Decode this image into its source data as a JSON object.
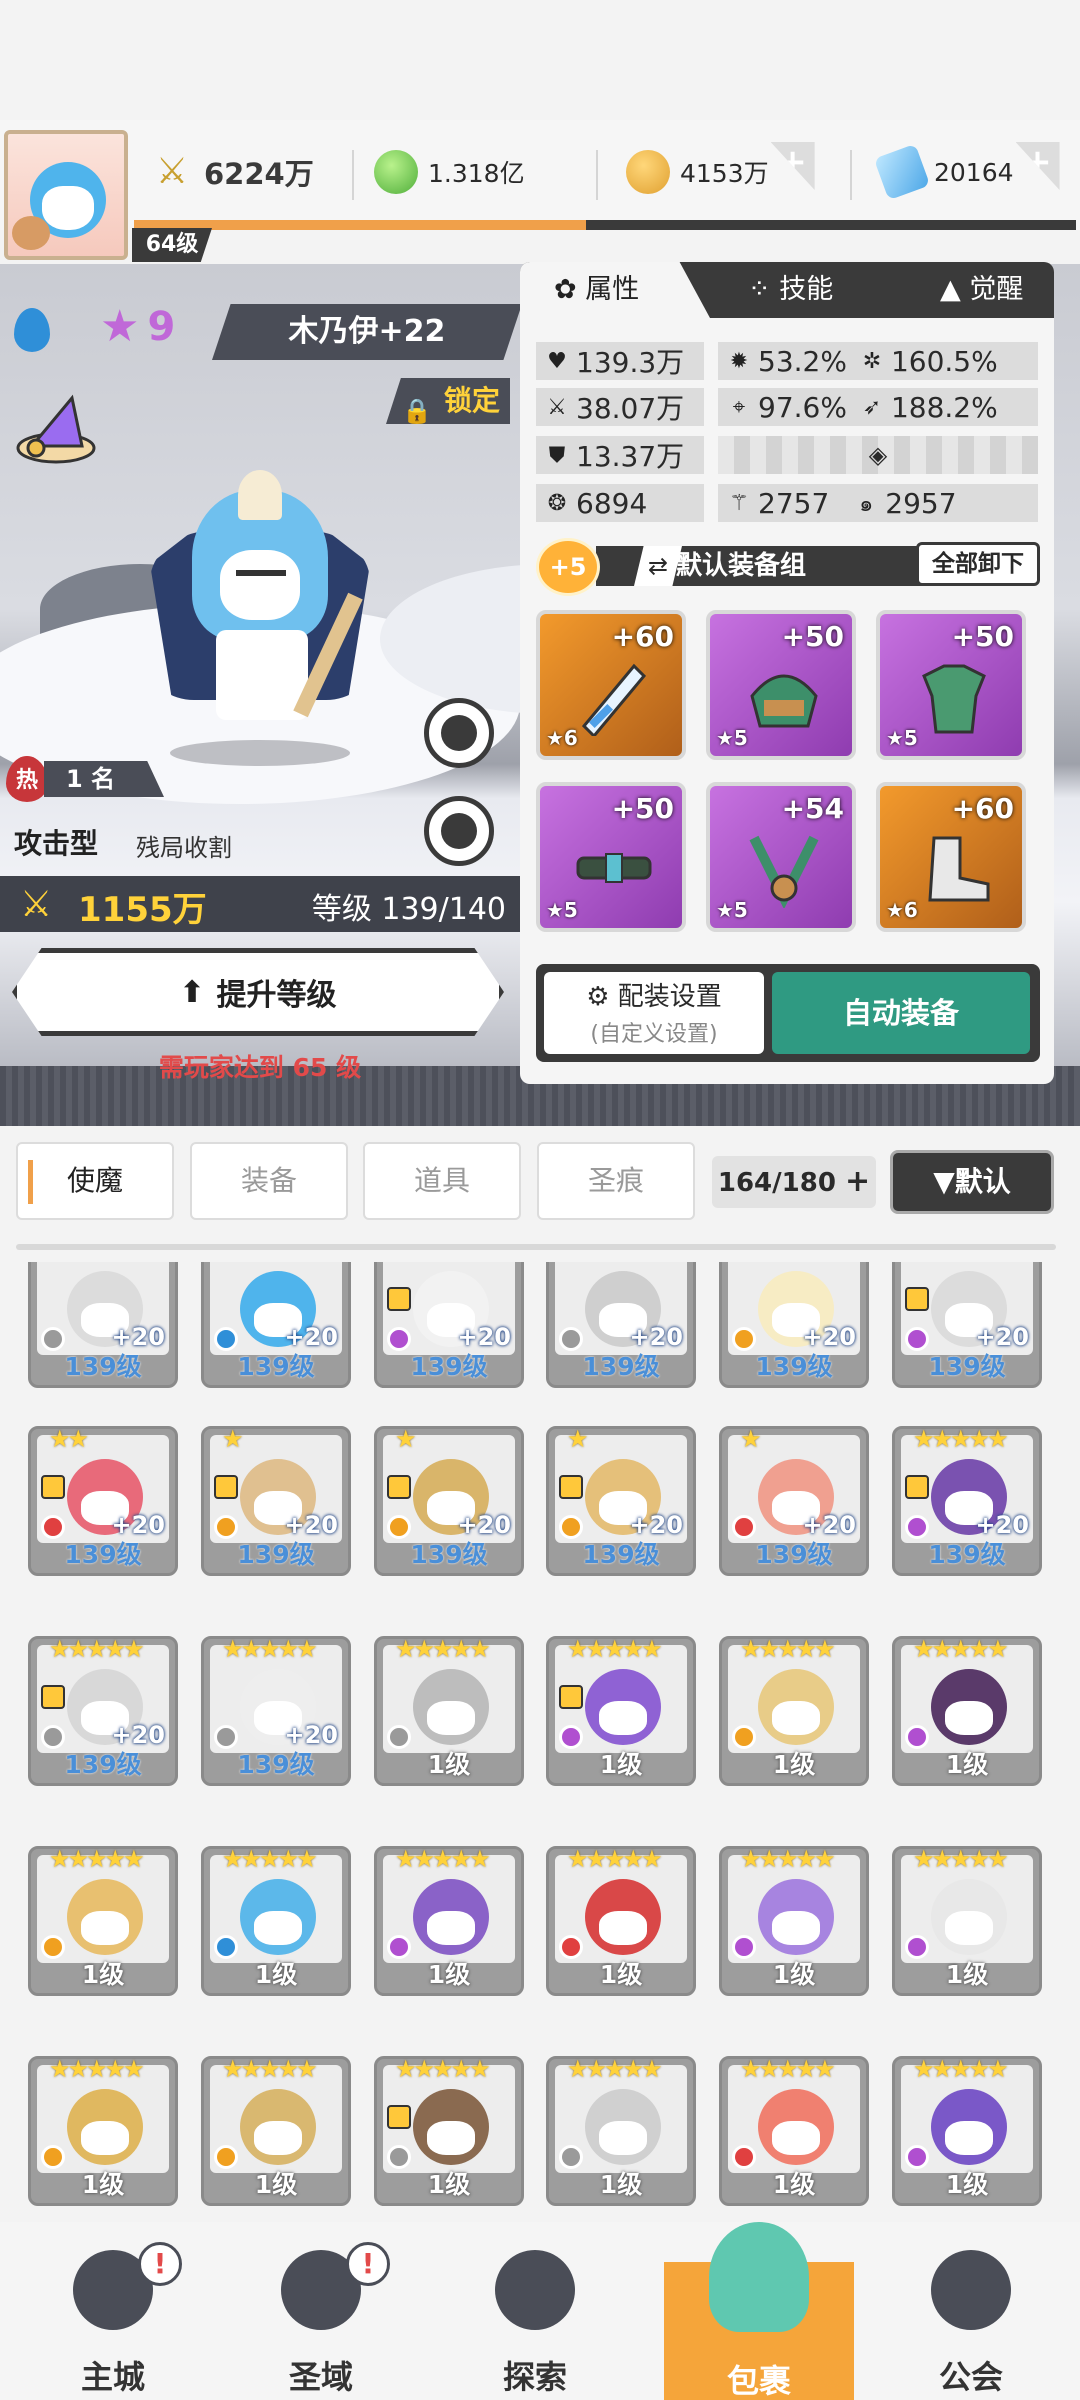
{
  "player": {
    "level": "64级",
    "exp_fraction": 0.48
  },
  "currencies": [
    {
      "icon": "swords-icon",
      "value": "6224万",
      "bold": true
    },
    {
      "icon": "green-orb-icon",
      "value": "1.318亿",
      "bold": false
    },
    {
      "icon": "gold-coin-icon",
      "value": "4153万",
      "bold": false,
      "plus": "+"
    },
    {
      "icon": "blue-gem-icon",
      "value": "20164",
      "bold": false,
      "plus": "+"
    }
  ],
  "hero": {
    "element": "water-drop-icon",
    "star_level": "9",
    "name": "木乃伊+22",
    "lock_label": "锁定",
    "hot_badge": "热",
    "rank": "1 名",
    "type": "攻击型",
    "tag": "残局收割",
    "power": "1155万",
    "level_text": "等级 139/140",
    "upgrade_label": "提升等级",
    "upgrade_note": "需玩家达到 65 级"
  },
  "panel": {
    "tabs": [
      "属性",
      "技能",
      "觉醒"
    ],
    "active_tab": 0,
    "stats": [
      [
        {
          "icon": "heart-icon",
          "value": "139.3万"
        },
        {
          "icon": "burst-icon",
          "value": "53.2%"
        },
        {
          "icon": "sun-icon",
          "value": "160.5%"
        }
      ],
      [
        {
          "icon": "sword-icon",
          "value": "38.07万"
        },
        {
          "icon": "crosshair-icon",
          "value": "97.6%"
        },
        {
          "icon": "wing-icon",
          "value": "188.2%"
        }
      ],
      [
        {
          "icon": "shield-icon",
          "value": "13.37万"
        }
      ],
      [
        {
          "icon": "swirl-icon",
          "value": "6894"
        },
        {
          "icon": "slash-icon",
          "value": "2757"
        },
        {
          "icon": "spiral-icon",
          "value": "2957"
        }
      ]
    ],
    "gear_set": {
      "badge": "+5",
      "name": "默认装备组",
      "unload_label": "全部卸下"
    },
    "gear": [
      {
        "rarity": "orange",
        "plus": "+60",
        "stars": "★6",
        "shape": "sword"
      },
      {
        "rarity": "purple",
        "plus": "+50",
        "stars": "★5",
        "shape": "helmet"
      },
      {
        "rarity": "purple",
        "plus": "+50",
        "stars": "★5",
        "shape": "armor"
      },
      {
        "rarity": "purple",
        "plus": "+50",
        "stars": "★5",
        "shape": "belt"
      },
      {
        "rarity": "purple",
        "plus": "+54",
        "stars": "★5",
        "shape": "amulet"
      },
      {
        "rarity": "orange",
        "plus": "+60",
        "stars": "★6",
        "shape": "boots"
      }
    ],
    "config_label": "配装设置",
    "config_sub": "(自定义设置)",
    "auto_label": "自动装备"
  },
  "inventory": {
    "tabs": [
      "使魔",
      "装备",
      "道具",
      "圣痕"
    ],
    "active_tab": 0,
    "count": "164/180",
    "count_plus": "+",
    "sort_label": "▼默认",
    "cards": [
      {
        "color": "#dcdcdc",
        "elem": "#9a9a9a",
        "stars": "",
        "plus": "+20",
        "lock": false,
        "level": "139级"
      },
      {
        "color": "#4fb4ec",
        "elem": "#2f8fd8",
        "stars": "",
        "plus": "+20",
        "lock": false,
        "level": "139级"
      },
      {
        "color": "#f2f2f2",
        "elem": "#b04fd0",
        "stars": "",
        "plus": "+20",
        "lock": true,
        "level": "139级"
      },
      {
        "color": "#cfcfcf",
        "elem": "#9a9a9a",
        "stars": "",
        "plus": "+20",
        "lock": false,
        "level": "139级"
      },
      {
        "color": "#f7ecc4",
        "elem": "#f0a020",
        "stars": "",
        "plus": "+20",
        "lock": false,
        "level": "139级"
      },
      {
        "color": "#dcdcdc",
        "elem": "#b04fd0",
        "stars": "",
        "plus": "+20",
        "lock": true,
        "level": "139级"
      },
      {
        "color": "#e86a7a",
        "elem": "#e04040",
        "stars": "★★",
        "plus": "+20",
        "lock": true,
        "level": "139级"
      },
      {
        "color": "#e0c090",
        "elem": "#f0a020",
        "stars": "★",
        "plus": "+20",
        "lock": true,
        "level": "139级"
      },
      {
        "color": "#d9b56a",
        "elem": "#f0a020",
        "stars": "★",
        "plus": "+20",
        "lock": true,
        "level": "139级"
      },
      {
        "color": "#e5c07a",
        "elem": "#f0a020",
        "stars": "★",
        "plus": "+20",
        "lock": true,
        "level": "139级"
      },
      {
        "color": "#f0a090",
        "elem": "#e04040",
        "stars": "★",
        "plus": "+20",
        "lock": false,
        "level": "139级"
      },
      {
        "color": "#7a52b0",
        "elem": "#b04fd0",
        "stars": "★★★★★",
        "plus": "+20",
        "lock": true,
        "level": "139级"
      },
      {
        "color": "#d8d8d8",
        "elem": "#9a9a9a",
        "stars": "★★★★★",
        "plus": "+20",
        "lock": true,
        "level": "139级"
      },
      {
        "color": "#eeeeee",
        "elem": "#9a9a9a",
        "stars": "★★★★★",
        "plus": "+20",
        "lock": false,
        "level": "139级"
      },
      {
        "color": "#bdbdbd",
        "elem": "#9a9a9a",
        "stars": "★★★★★",
        "plus": "",
        "lock": false,
        "level": "1级"
      },
      {
        "color": "#8f62d4",
        "elem": "#b04fd0",
        "stars": "★★★★★",
        "plus": "",
        "lock": true,
        "level": "1级"
      },
      {
        "color": "#e8cc88",
        "elem": "#f0a020",
        "stars": "★★★★★",
        "plus": "",
        "lock": false,
        "level": "1级"
      },
      {
        "color": "#5a3a6a",
        "elem": "#b04fd0",
        "stars": "★★★★★",
        "plus": "",
        "lock": false,
        "level": "1级"
      },
      {
        "color": "#e8c070",
        "elem": "#f0a020",
        "stars": "★★★★★",
        "plus": "",
        "lock": false,
        "level": "1级"
      },
      {
        "color": "#5cb8ea",
        "elem": "#2f8fd8",
        "stars": "★★★★★",
        "plus": "",
        "lock": false,
        "level": "1级"
      },
      {
        "color": "#8a62c8",
        "elem": "#b04fd0",
        "stars": "★★★★★",
        "plus": "",
        "lock": false,
        "level": "1级"
      },
      {
        "color": "#d94848",
        "elem": "#e04040",
        "stars": "★★★★★",
        "plus": "",
        "lock": false,
        "level": "1级"
      },
      {
        "color": "#a784e0",
        "elem": "#b04fd0",
        "stars": "★★★★★",
        "plus": "",
        "lock": false,
        "level": "1级"
      },
      {
        "color": "#e8e8e8",
        "elem": "#b04fd0",
        "stars": "★★★★★",
        "plus": "",
        "lock": false,
        "level": "1级"
      },
      {
        "color": "#e0b860",
        "elem": "#f0a020",
        "stars": "★★★★★",
        "plus": "",
        "lock": false,
        "level": "1级"
      },
      {
        "color": "#d9b870",
        "elem": "#f0a020",
        "stars": "★★★★★",
        "plus": "",
        "lock": false,
        "level": "1级"
      },
      {
        "color": "#8a6a50",
        "elem": "#9a9a9a",
        "stars": "★★★★★",
        "plus": "",
        "lock": true,
        "level": "1级"
      },
      {
        "color": "#d0d0d0",
        "elem": "#9a9a9a",
        "stars": "★★★★★",
        "plus": "",
        "lock": false,
        "level": "1级"
      },
      {
        "color": "#f08070",
        "elem": "#e04040",
        "stars": "★★★★★",
        "plus": "",
        "lock": false,
        "level": "1级"
      },
      {
        "color": "#7a58c8",
        "elem": "#b04fd0",
        "stars": "★★★★★",
        "plus": "",
        "lock": false,
        "level": "1级"
      }
    ]
  },
  "nav": [
    {
      "label": "主城",
      "icon": "castle-icon",
      "alert": "!"
    },
    {
      "label": "圣域",
      "icon": "vortex-icon",
      "alert": "!"
    },
    {
      "label": "探索",
      "icon": "sword-stone-icon",
      "alert": ""
    },
    {
      "label": "包裹",
      "icon": "bag-icon",
      "alert": "",
      "active": true
    },
    {
      "label": "公会",
      "icon": "guild-helmet-icon",
      "alert": ""
    }
  ]
}
